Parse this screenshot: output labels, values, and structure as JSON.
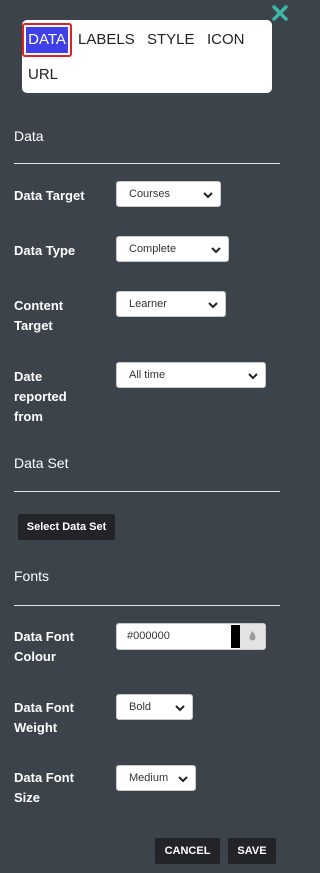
{
  "tabs": [
    {
      "label": "DATA",
      "active": true
    },
    {
      "label": "LABELS"
    },
    {
      "label": "STYLE"
    },
    {
      "label": "ICON"
    },
    {
      "label": "URL"
    }
  ],
  "sections": {
    "data": "Data",
    "data_set": "Data Set",
    "fonts": "Fonts"
  },
  "fields": {
    "data_target": {
      "label": "Data Target",
      "value": "Courses"
    },
    "data_type": {
      "label": "Data Type",
      "value": "Complete"
    },
    "content_target": {
      "label_line1": "Content",
      "label_line2": "Target",
      "value": "Learner"
    },
    "date_reported": {
      "label_line1": "Date",
      "label_line2": "reported",
      "label_line3": "from",
      "value": "All time"
    },
    "font_colour": {
      "label_line1": "Data Font",
      "label_line2": "Colour",
      "value": "#000000"
    },
    "font_weight": {
      "label_line1": "Data Font",
      "label_line2": "Weight",
      "value": "Bold"
    },
    "font_size": {
      "label_line1": "Data Font",
      "label_line2": "Size",
      "value": "Medium"
    }
  },
  "buttons": {
    "select_data_set": "Select Data Set",
    "cancel": "CANCEL",
    "save": "SAVE"
  },
  "colors": {
    "background": "#3d434b",
    "accent_tab": "#4040e8",
    "tab_border": "#e0202b",
    "close_icon": "#3fb6a8"
  },
  "icons": {
    "close": "close-icon",
    "select_arrow": "chevron-down-icon",
    "color_drop": "water-drop-icon"
  }
}
